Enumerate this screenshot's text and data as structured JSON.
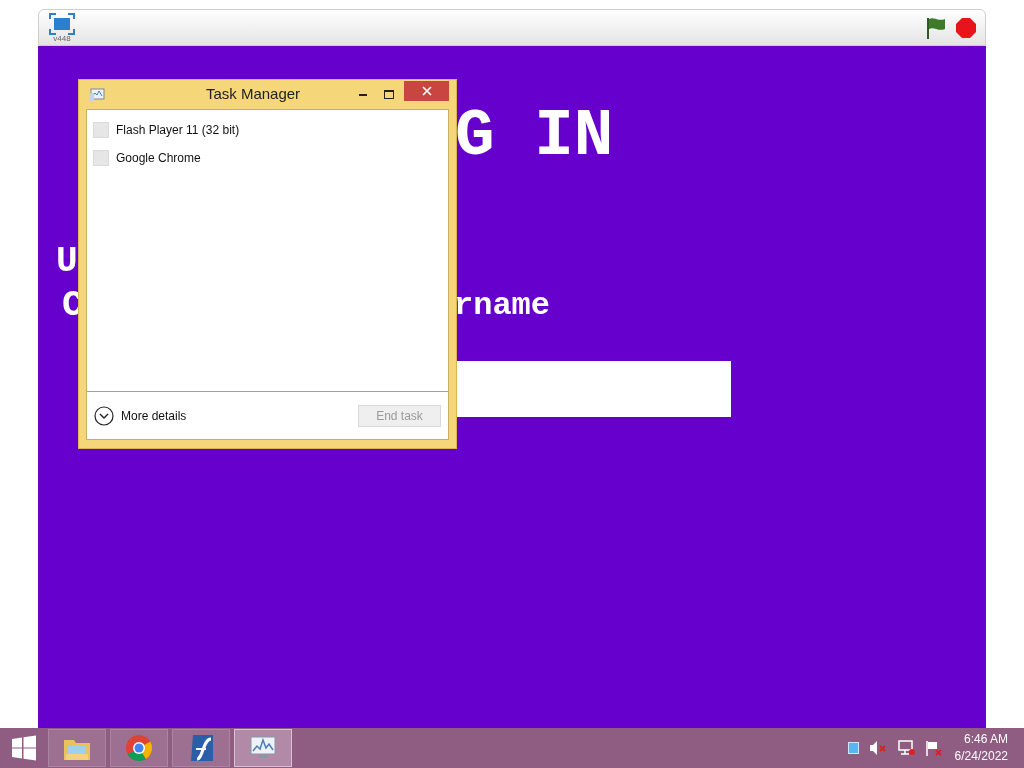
{
  "player": {
    "version": "v448"
  },
  "stage": {
    "texts": [
      {
        "kind": "title",
        "text": "G IN"
      },
      {
        "kind": "initial",
        "text": "U"
      },
      {
        "kind": "initial2",
        "text": "C"
      },
      {
        "kind": "label",
        "text": "rname"
      }
    ]
  },
  "task_manager": {
    "title": "Task Manager",
    "processes": [
      "Flash Player 11 (32 bit)",
      "Google Chrome"
    ],
    "more_details": "More details",
    "end_task": {
      "label": "End task",
      "disabled": true
    }
  },
  "taskbar": {
    "apps": [
      {
        "kind": "explorer",
        "selected": false
      },
      {
        "kind": "chrome",
        "selected": false
      },
      {
        "kind": "flash",
        "selected": false
      },
      {
        "kind": "taskmanager",
        "selected": true
      }
    ],
    "time": "6:46 AM",
    "date": "6/24/2022"
  }
}
